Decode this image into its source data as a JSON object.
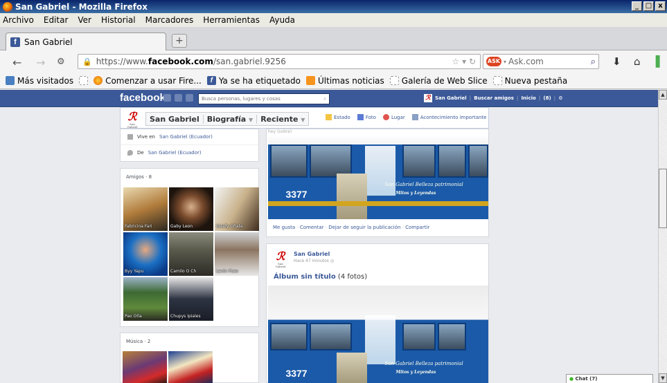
{
  "window": {
    "title": "San Gabriel - Mozilla Firefox",
    "buttons": [
      "_",
      "□",
      "x"
    ]
  },
  "menu": {
    "items": [
      {
        "label": "Archivo"
      },
      {
        "label": "Editar"
      },
      {
        "label": "Ver"
      },
      {
        "label": "Historial"
      },
      {
        "label": "Marcadores"
      },
      {
        "label": "Herramientas"
      },
      {
        "label": "Ayuda"
      }
    ]
  },
  "tabs": {
    "active_title": "San Gabriel",
    "new_tab": "+"
  },
  "nav": {
    "url_prefix": "https://www.",
    "url_domain": "facebook.com",
    "url_path": "/san.gabriel.9256",
    "search_placeholder": "Ask.com"
  },
  "bookmarks": [
    {
      "label": "Más visitados",
      "icon": "blue"
    },
    {
      "label": "",
      "icon": "blank"
    },
    {
      "label": "Comenzar a usar Fire...",
      "icon": "ff"
    },
    {
      "label": "Ya se ha etiquetado",
      "icon": "fb"
    },
    {
      "label": "Últimas noticias",
      "icon": "rss"
    },
    {
      "label": "Galería de Web Slice",
      "icon": "blank"
    },
    {
      "label": "Nueva pestaña",
      "icon": "blank"
    }
  ],
  "fb": {
    "logo": "facebook",
    "search_placeholder": "Busca personas, lugares y cosas",
    "profile_name": "San Gabriel",
    "find_friends": "Buscar amigos",
    "home": "Inicio",
    "counter": "(8)"
  },
  "timeline": {
    "name": "San Gabriel",
    "biografia": "Biografía",
    "reciente": "Reciente",
    "actions": [
      "Estado",
      "Foto",
      "Lugar",
      "Acontecimiento importante"
    ]
  },
  "info": {
    "lives_prefix": "Vive en",
    "lives_place": "San Gabriel (Ecuador)",
    "from_prefix": "De",
    "from_place": "San Gabriel (Ecuador)"
  },
  "friends": {
    "header": "Amigos · 8",
    "items": [
      {
        "name": "Fabricina Fari"
      },
      {
        "name": "Gaby Leon"
      },
      {
        "name": "Estefy Oñate"
      },
      {
        "name": "Byy Yapu"
      },
      {
        "name": "Camilo O Ch"
      },
      {
        "name": "Lenin Poso"
      },
      {
        "name": "Pao Oña"
      },
      {
        "name": "Chupys Ipiales"
      }
    ]
  },
  "music": {
    "header": "Música · 2"
  },
  "post1": {
    "timestamp": "hey (sobre)",
    "bus_number": "3377",
    "slogan": "San Gabriel Belleza patrimonial",
    "sub_slogan": "Mitos y Leyendas",
    "link_like": "Me gusta",
    "link_comment": "Comentar",
    "link_unfollow": "Dejar de seguir la publicación",
    "link_share": "Compartir"
  },
  "post2": {
    "author": "San Gabriel",
    "time": "Hace 47 minutos",
    "album_title": "Álbum sin título",
    "album_count": "(4 fotos)",
    "bus_number": "3377",
    "slogan": "San Gabriel Belleza patrimonial",
    "sub_slogan": "Mitos y Leyendas"
  },
  "chat": {
    "label": "Chat (7)"
  },
  "colors": {
    "fb_blue": "#3b5998",
    "bus_blue": "#1b5aa8"
  }
}
